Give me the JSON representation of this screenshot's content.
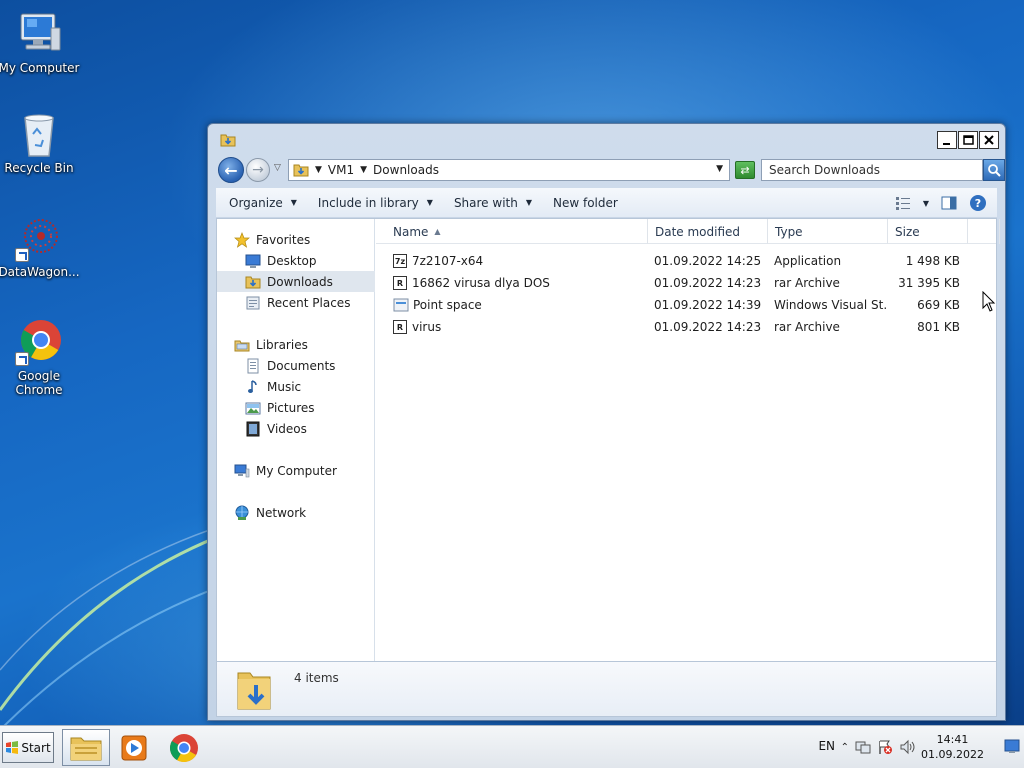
{
  "desktop": {
    "icons": [
      {
        "label": "My Computer"
      },
      {
        "label": "Recycle Bin"
      },
      {
        "label": "DataWagon..."
      },
      {
        "label": "Google Chrome"
      }
    ]
  },
  "window": {
    "address": {
      "crumbs": [
        "VM1",
        "Downloads"
      ],
      "search_placeholder": "Search Downloads"
    },
    "toolbar": {
      "organize": "Organize",
      "include_in_library": "Include in library",
      "share_with": "Share with",
      "new_folder": "New folder"
    },
    "nav": {
      "favorites": "Favorites",
      "desktop": "Desktop",
      "downloads": "Downloads",
      "recent_places": "Recent Places",
      "libraries": "Libraries",
      "documents": "Documents",
      "music": "Music",
      "pictures": "Pictures",
      "videos": "Videos",
      "my_computer": "My Computer",
      "network": "Network"
    },
    "columns": {
      "name": "Name",
      "date_modified": "Date modified",
      "type": "Type",
      "size": "Size"
    },
    "files": [
      {
        "name": "7z2107-x64",
        "date": "01.09.2022 14:25",
        "type": "Application",
        "size": "1 498 KB",
        "icon": "7z"
      },
      {
        "name": "16862 virusa dlya DOS",
        "date": "01.09.2022 14:23",
        "type": "rar Archive",
        "size": "31 395 KB",
        "icon": "R"
      },
      {
        "name": "Point space",
        "date": "01.09.2022 14:39",
        "type": "Windows Visual St...",
        "size": "669 KB",
        "icon": "vs"
      },
      {
        "name": "virus",
        "date": "01.09.2022 14:23",
        "type": "rar Archive",
        "size": "801 KB",
        "icon": "R"
      }
    ],
    "details": {
      "item_count": "4 items"
    }
  },
  "taskbar": {
    "start_label": "Start",
    "language": "EN",
    "time": "14:41",
    "date": "01.09.2022"
  },
  "colors": {
    "desktop_blue": "#1667c2",
    "window_frame": "#c3d3e6",
    "selection": "#dfe6ee"
  }
}
